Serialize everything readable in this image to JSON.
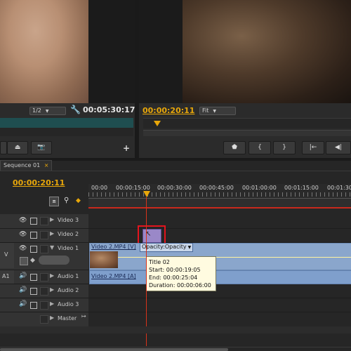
{
  "source_monitor": {
    "zoom": "1/2",
    "timecode": "00:05:30:17"
  },
  "program_monitor": {
    "timecode": "00:00:20:11",
    "fit": "Fit"
  },
  "program_controls": {
    "marker": "⬟",
    "in": "{",
    "out": "}",
    "go_to_in": "|←",
    "step_back": "◀|"
  },
  "timeline": {
    "tab": "Sequence 01",
    "timecode": "00:00:20:11",
    "ruler": [
      "00:00",
      "00:00:15:00",
      "00:00:30:00",
      "00:00:45:00",
      "00:01:00:00",
      "00:01:15:00",
      "00:01:30"
    ],
    "tracks": {
      "video3": "Video 3",
      "video2": "Video 2",
      "video1": "Video 1",
      "v_label": "V",
      "a1_label": "A1",
      "audio1": "Audio 1",
      "audio2": "Audio 2",
      "audio3": "Audio 3",
      "master": "Master"
    },
    "clips": {
      "video_clip": "Video 2.MP4 [V]",
      "opacity": "Opacity:Opacity",
      "audio_clip": "Video 2.MP4 [A]"
    },
    "tooltip": {
      "title": "Title 02",
      "start": "Start: 00:00:19:05",
      "end": "End: 00:00:25:04",
      "duration": "Duration: 00:00:06:00"
    }
  },
  "colors": {
    "accent_orange": "#e8a70a",
    "playhead_red": "#d8341b",
    "highlight_red": "#e3141e",
    "clip_blue": "#8aa6cc"
  }
}
